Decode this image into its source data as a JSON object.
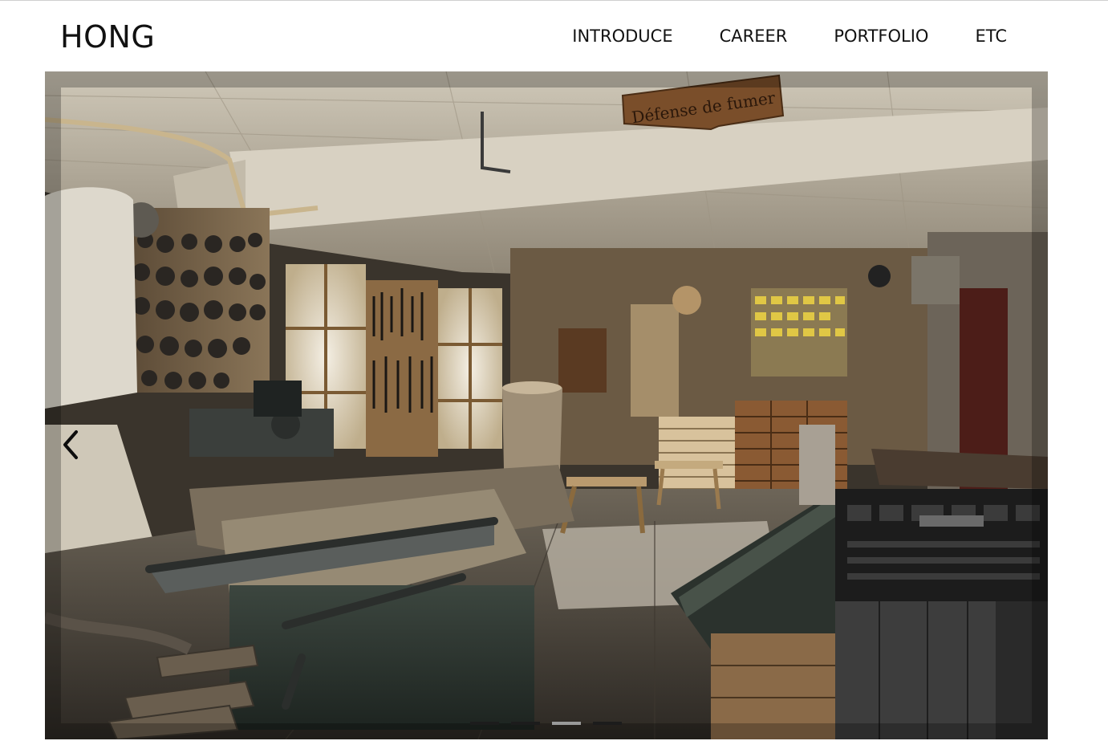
{
  "brand": {
    "name": "HONG"
  },
  "nav": {
    "items": [
      {
        "label": "INTRODUCE"
      },
      {
        "label": "CAREER"
      },
      {
        "label": "PORTFOLIO"
      },
      {
        "label": "ETC"
      }
    ]
  },
  "carousel": {
    "prev_icon": "chevron-left-icon",
    "slide_sign_text": "Défense de fumer",
    "indicator_count": 4,
    "active_indicator": 3
  }
}
